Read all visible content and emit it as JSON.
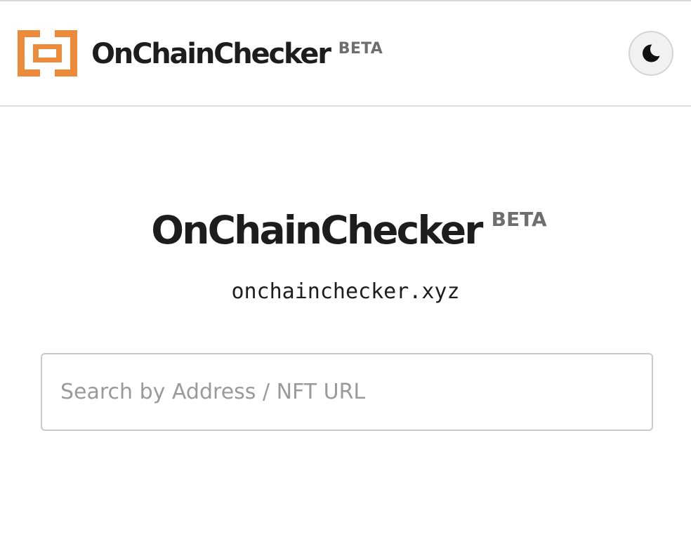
{
  "colors": {
    "brand_orange": "#EE8B3A",
    "text_dark": "#1D1D1D",
    "beta_gray": "#6E6E6E",
    "placeholder_gray": "#9A9A9A"
  },
  "header": {
    "brand_name": "OnChainChecker",
    "beta_label": "BETA",
    "logo_icon": "brackets-logo-icon",
    "theme_toggle_icon": "moon-icon"
  },
  "hero": {
    "title": "OnChainChecker",
    "beta_label": "BETA",
    "domain": "onchainchecker.xyz"
  },
  "search": {
    "value": "",
    "placeholder": "Search by Address / NFT URL"
  }
}
